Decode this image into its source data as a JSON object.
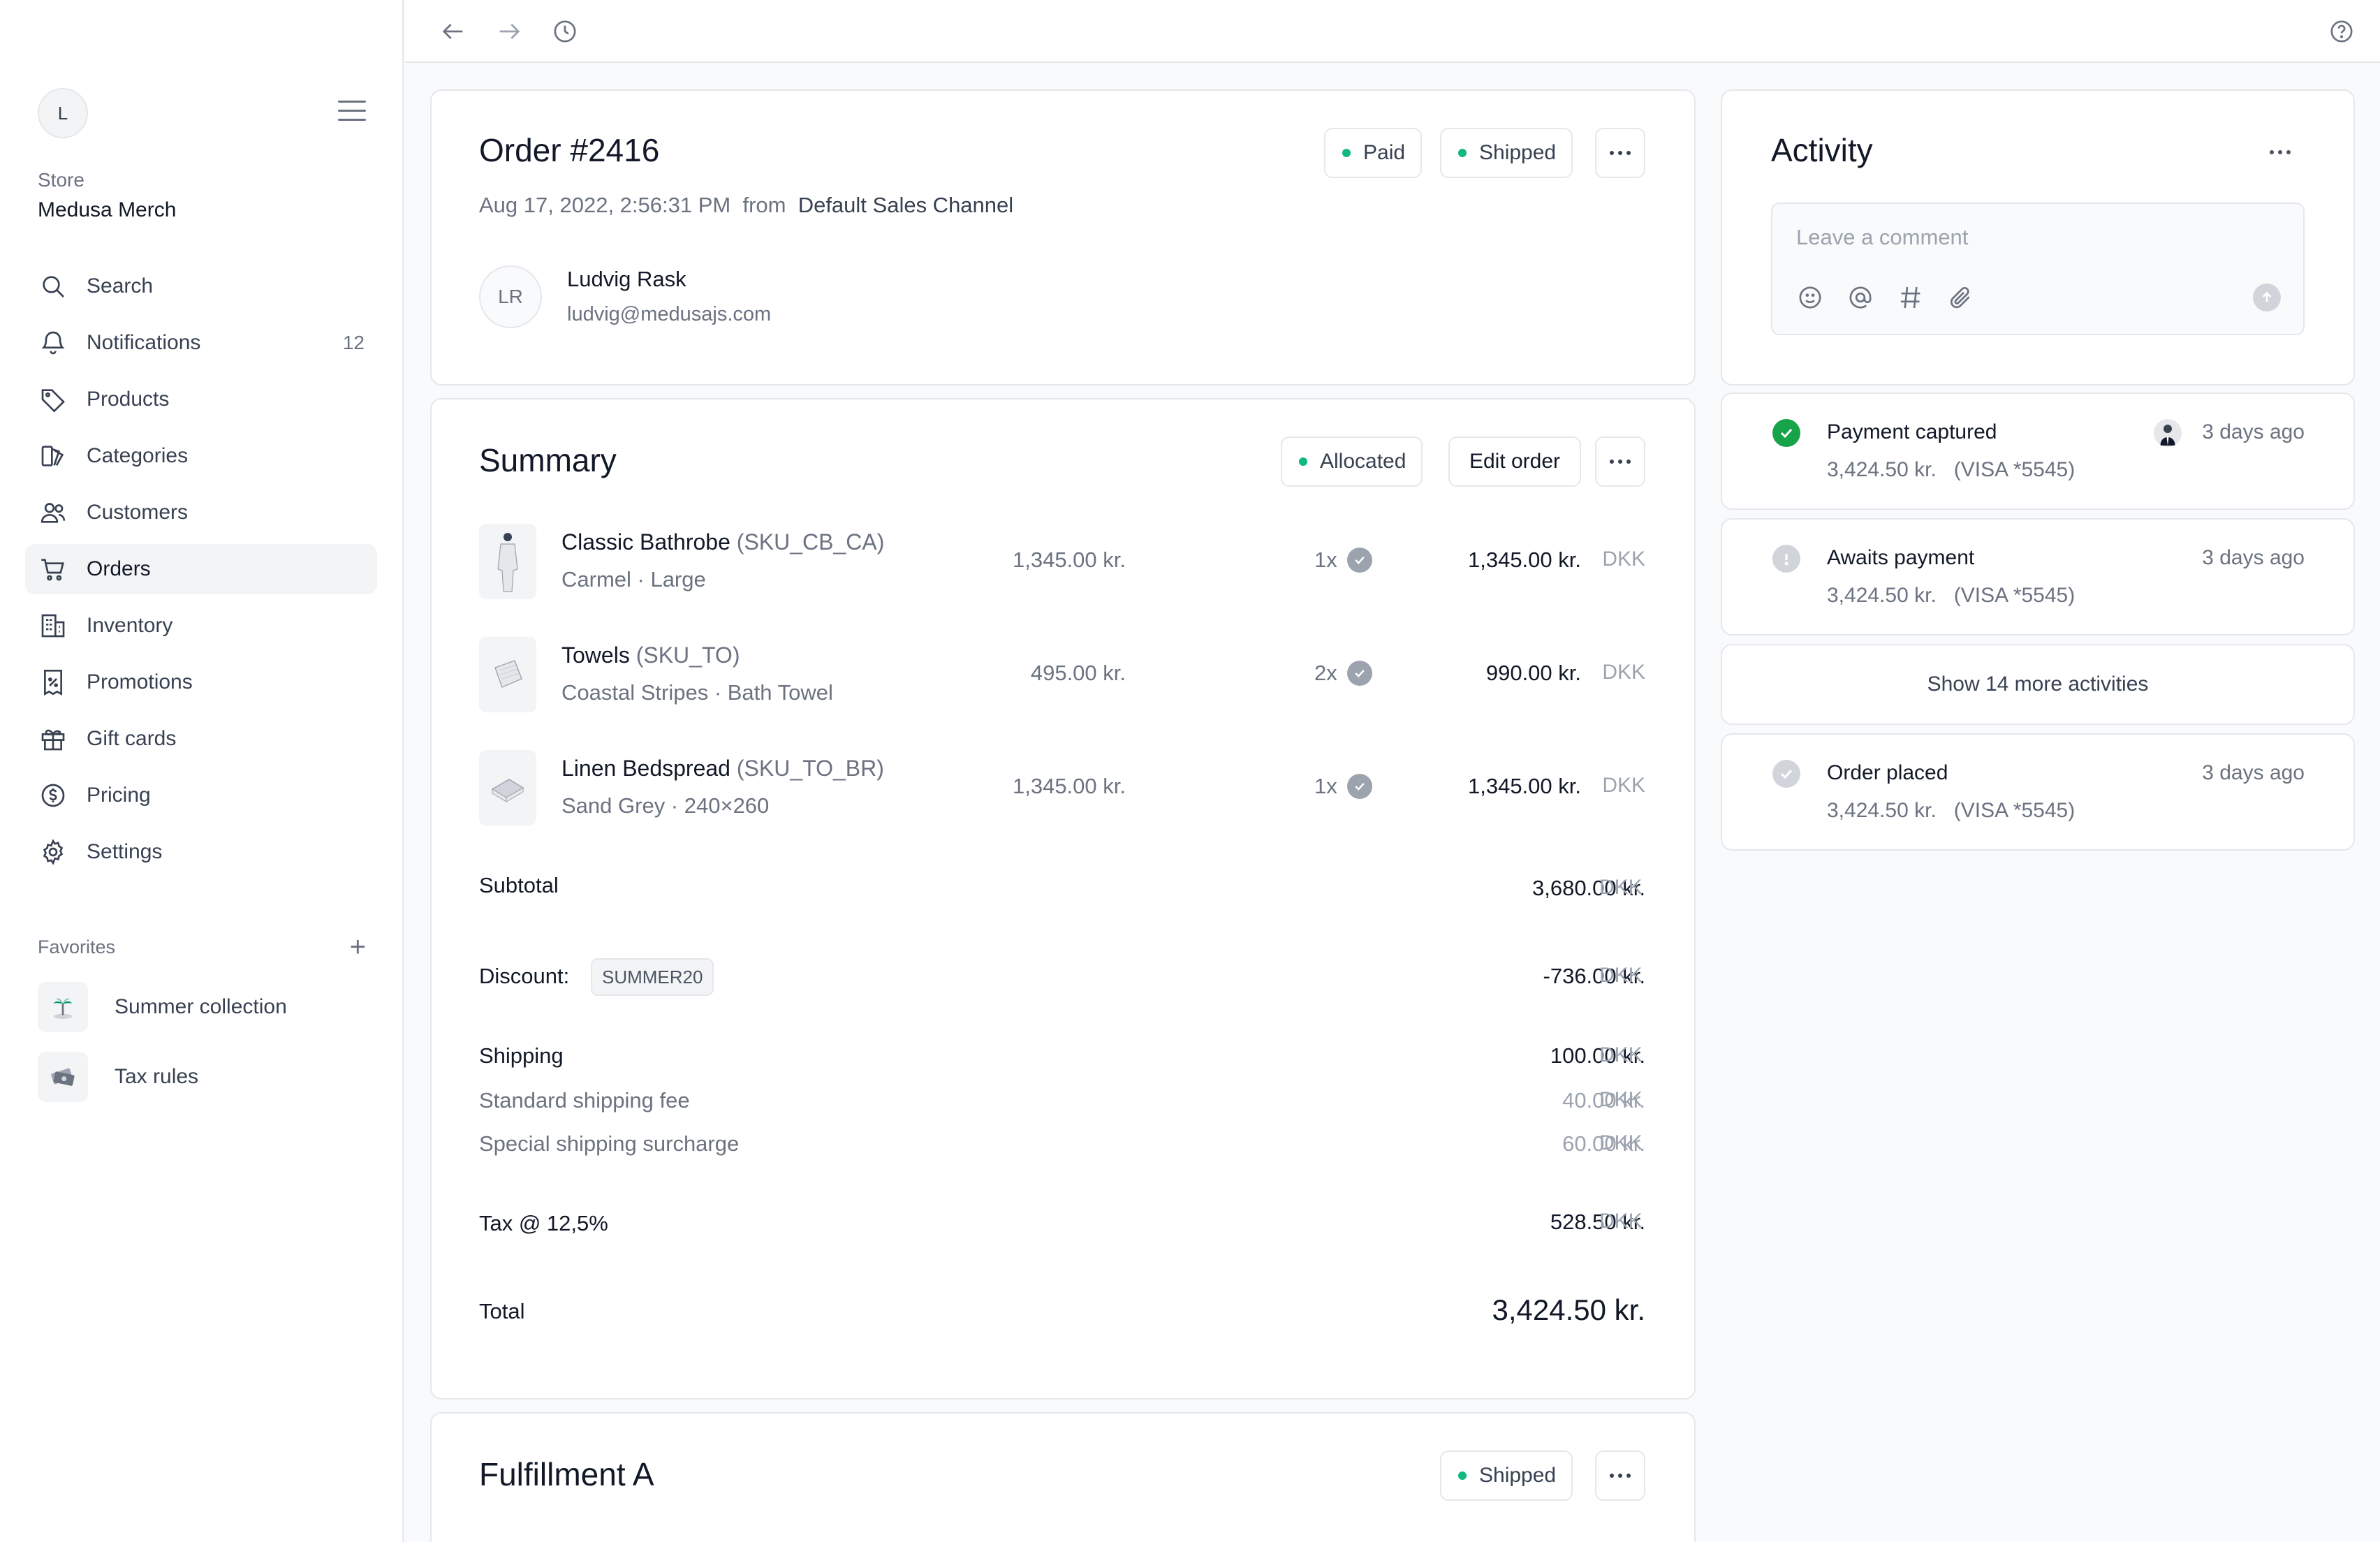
{
  "sidebar": {
    "avatar_initial": "L",
    "store_label": "Store",
    "store_name": "Medusa Merch",
    "nav": [
      {
        "label": "Search",
        "icon": "search-icon"
      },
      {
        "label": "Notifications",
        "icon": "bell-icon",
        "count": "12"
      },
      {
        "label": "Products",
        "icon": "tag-icon"
      },
      {
        "label": "Categories",
        "icon": "categories-icon"
      },
      {
        "label": "Customers",
        "icon": "users-icon"
      },
      {
        "label": "Orders",
        "icon": "cart-icon",
        "active": true
      },
      {
        "label": "Inventory",
        "icon": "building-icon"
      },
      {
        "label": "Promotions",
        "icon": "receipt-percent-icon"
      },
      {
        "label": "Gift cards",
        "icon": "gift-icon"
      },
      {
        "label": "Pricing",
        "icon": "currency-icon"
      },
      {
        "label": "Settings",
        "icon": "gear-icon"
      }
    ],
    "favorites_label": "Favorites",
    "favorites": [
      {
        "label": "Summer collection",
        "icon": "island-icon"
      },
      {
        "label": "Tax rules",
        "icon": "money-icon"
      }
    ]
  },
  "order": {
    "title": "Order #2416",
    "status_paid": "Paid",
    "status_shipped": "Shipped",
    "date": "Aug 17, 2022, 2:56:31 PM",
    "from_label": "from",
    "channel": "Default Sales Channel",
    "customer": {
      "initials": "LR",
      "name": "Ludvig Rask",
      "email": "ludvig@medusajs.com"
    }
  },
  "summary": {
    "title": "Summary",
    "allocated": "Allocated",
    "edit_label": "Edit order",
    "currency": "DKK",
    "items": [
      {
        "name": "Classic Bathrobe",
        "sku": "(SKU_CB_CA)",
        "variant": "Carmel · Large",
        "price": "1,345.00 kr.",
        "qty": "1x",
        "total": "1,345.00 kr."
      },
      {
        "name": "Towels",
        "sku": "(SKU_TO)",
        "variant": "Coastal Stripes · Bath Towel",
        "price": "495.00 kr.",
        "qty": "2x",
        "total": "990.00 kr."
      },
      {
        "name": "Linen Bedspread",
        "sku": "(SKU_TO_BR)",
        "variant": "Sand Grey · 240×260",
        "price": "1,345.00 kr.",
        "qty": "1x",
        "total": "1,345.00 kr."
      }
    ],
    "subtotal_label": "Subtotal",
    "subtotal": "3,680.00 kr.",
    "discount_label": "Discount:",
    "discount_code": "SUMMER20",
    "discount": "-736.00 kr.",
    "shipping_label": "Shipping",
    "shipping": "100.00 kr.",
    "standard_label": "Standard shipping fee",
    "standard": "40.00 kr.",
    "special_label": "Special shipping surcharge",
    "special": "60.00 kr.",
    "tax_label": "Tax @ 12,5%",
    "tax": "528.50 kr.",
    "total_label": "Total",
    "total": "3,424.50 kr."
  },
  "fulfillment": {
    "title": "Fulfillment A",
    "status": "Shipped"
  },
  "activity": {
    "title": "Activity",
    "comment_placeholder": "Leave a comment",
    "events": [
      {
        "title": "Payment captured",
        "detail": "3,424.50 kr.   (VISA *5545)",
        "time": "3 days ago"
      },
      {
        "title": "Awaits payment",
        "detail": "3,424.50 kr.   (VISA *5545)",
        "time": "3 days ago"
      },
      {
        "title": "Order placed",
        "detail": "3,424.50 kr.   (VISA *5545)",
        "time": "3 days ago"
      }
    ],
    "show_more": "Show 14 more activities"
  },
  "colors": {
    "accent_green": "#10b981",
    "success_green": "#16a34a"
  }
}
